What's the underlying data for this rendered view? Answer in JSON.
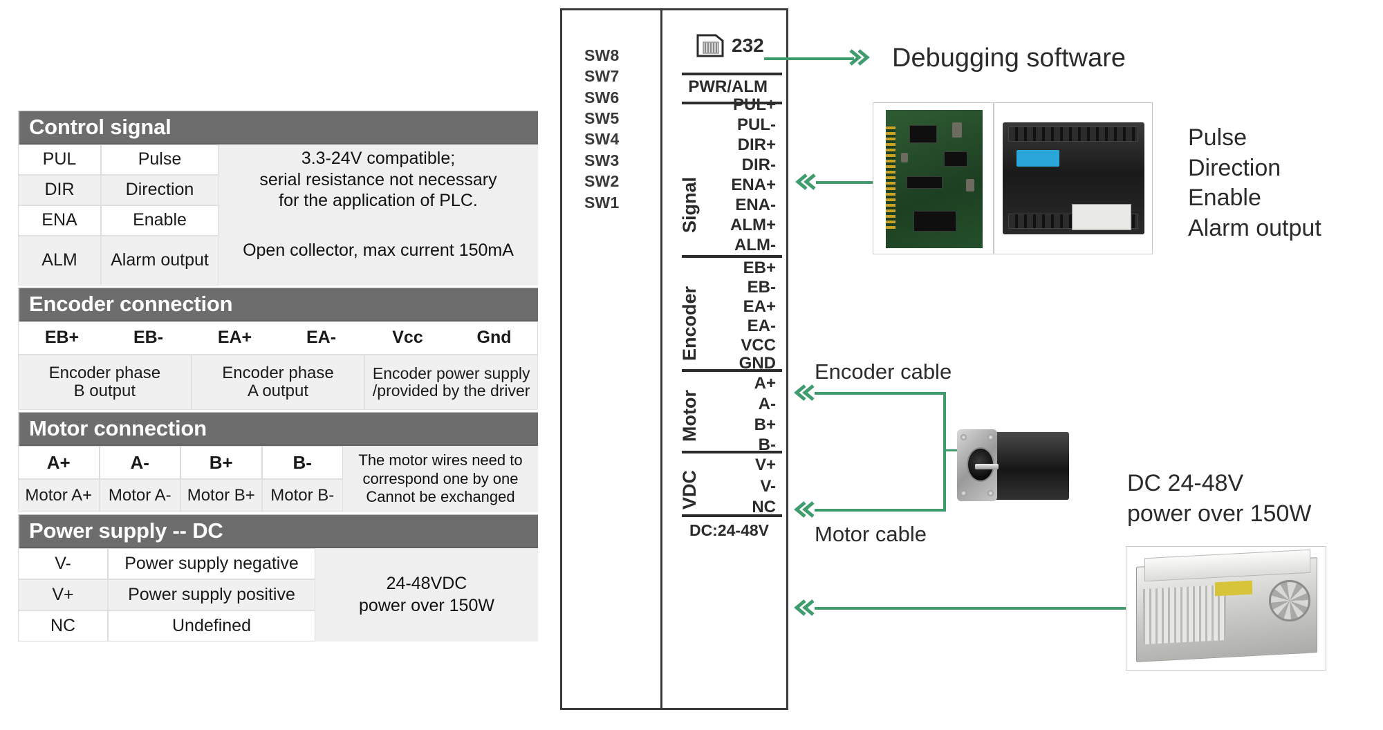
{
  "left_panel": {
    "sections": [
      {
        "title": "Control signal",
        "rows": [
          {
            "key": "PUL",
            "value": "Pulse"
          },
          {
            "key": "DIR",
            "value": "Direction"
          },
          {
            "key": "ENA",
            "value": "Enable"
          },
          {
            "key": "ALM",
            "value": "Alarm output"
          }
        ],
        "note_top": "3.3-24V compatible;\nserial resistance not necessary\nfor the application of PLC.",
        "note_top_lines": [
          "3.3-24V compatible;",
          "serial resistance not necessary",
          "for the application of PLC."
        ],
        "note_bottom": "Open collector, max current 150mA"
      },
      {
        "title": "Encoder connection",
        "terminals": [
          "EB+",
          "EB-",
          "EA+",
          "EA-",
          "Vcc",
          "Gnd"
        ],
        "descriptions": [
          {
            "line1": "Encoder phase",
            "line2": "B output"
          },
          {
            "line1": "Encoder phase",
            "line2": "A output"
          },
          {
            "line1": "Encoder power supply",
            "line2": "/provided by the driver"
          }
        ]
      },
      {
        "title": "Motor connection",
        "terminals": [
          "A+",
          "A-",
          "B+",
          "B-"
        ],
        "values": [
          "Motor A+",
          "Motor A-",
          "Motor B+",
          "Motor B-"
        ],
        "note_lines": [
          "The motor wires need to",
          "correspond one by one",
          "Cannot be exchanged"
        ]
      },
      {
        "title": "Power supply -- DC",
        "rows": [
          {
            "key": "V-",
            "value": "Power supply negative"
          },
          {
            "key": "V+",
            "value": "Power supply positive"
          },
          {
            "key": "NC",
            "value": "Undefined"
          }
        ],
        "note_lines": [
          "24-48VDC",
          "power over 150W"
        ]
      }
    ]
  },
  "driver": {
    "dip_switches": [
      "SW8",
      "SW7",
      "SW6",
      "SW5",
      "SW4",
      "SW3",
      "SW2",
      "SW1"
    ],
    "port_icon": "rj11-port-icon",
    "port_label": "232",
    "pwr_alm_label": "PWR/ALM",
    "groups": [
      {
        "name": "Signal",
        "terminals": [
          "PUL+",
          "PUL-",
          "DIR+",
          "DIR-",
          "ENA+",
          "ENA-",
          "ALM+",
          "ALM-"
        ]
      },
      {
        "name": "Encoder",
        "terminals": [
          "EB+",
          "EB-",
          "EA+",
          "EA-",
          "VCC",
          "GND"
        ]
      },
      {
        "name": "Motor",
        "terminals": [
          "A+",
          "A-",
          "B+",
          "B-"
        ]
      },
      {
        "name": "VDC",
        "terminals": [
          "V+",
          "V-",
          "NC"
        ]
      }
    ],
    "footer_label": "DC:24-48V"
  },
  "annotations": {
    "debugging_software": "Debugging software",
    "controller_functions": [
      "Pulse",
      "Direction",
      "Enable",
      "Alarm output"
    ],
    "encoder_cable": "Encoder cable",
    "motor_cable": "Motor cable",
    "power_supply_lines": [
      "DC 24-48V",
      "power over 150W"
    ]
  },
  "colors": {
    "header_gray": "#6d6d6d",
    "connector_green": "#3f9d6d",
    "box_outline": "#3a3a3a",
    "text_dark": "#2b2b2b"
  },
  "photos": {
    "pcb_card": "motion-control-card-photo",
    "plc_module": "plc-module-photo",
    "stepper_motor": "stepper-motor-photo",
    "power_supply": "switching-power-supply-photo"
  }
}
